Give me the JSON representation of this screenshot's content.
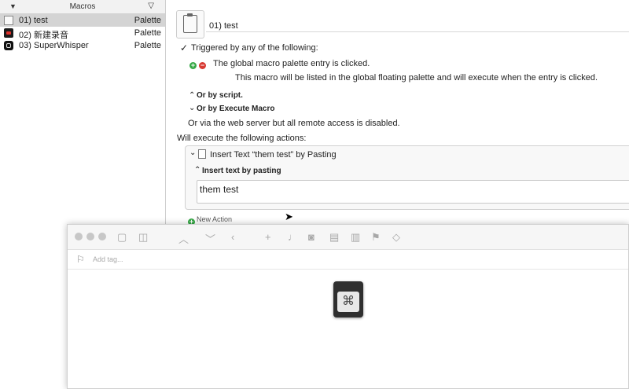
{
  "macros_pane": {
    "header_title": "Macros",
    "items": [
      {
        "name": "01) test",
        "trigger": "Palette",
        "icon": "document-icon",
        "selected": true
      },
      {
        "name": "02) 新建录音",
        "trigger": "Palette",
        "icon": "recorder-app-icon",
        "selected": false
      },
      {
        "name": "03) SuperWhisper",
        "trigger": "Palette",
        "icon": "superwhisper-app-icon",
        "selected": false
      }
    ]
  },
  "editor": {
    "macro_name": "01) test",
    "triggered_label": "Triggered by any of the following:",
    "palette_trigger": "The global macro palette entry is clicked.",
    "palette_description": "This macro will be listed in the global floating palette and will execute when the entry is clicked.",
    "or_by_script": "Or by script.",
    "or_by_execute": "Or by Execute Macro",
    "web_server_note": "Or via the web server but all remote access is disabled.",
    "will_execute": "Will execute the following actions:",
    "action": {
      "title": "Insert Text “them test” by Pasting",
      "method_label": "Insert text by pasting",
      "text_value": "them test"
    },
    "new_action": "New Action"
  },
  "foreground_window": {
    "tag_placeholder": "Add tag...",
    "toolbar_icons": [
      "sidebar-icon",
      "panel-icon",
      "chevron-up-icon",
      "chevron-down-icon",
      "back-icon",
      "plus-icon",
      "mic-icon",
      "camera-icon",
      "doc-icon",
      "trash-icon",
      "flag-icon",
      "tag-icon"
    ]
  },
  "colors": {
    "selection": "#d4d4d4",
    "add_green": "#35a845",
    "remove_red": "#d83a33"
  }
}
